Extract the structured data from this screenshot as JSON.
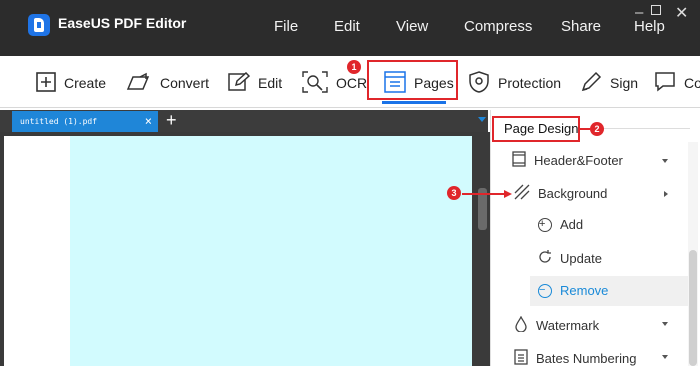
{
  "app": {
    "title": "EaseUS PDF Editor"
  },
  "menu": {
    "items": [
      "File",
      "Edit",
      "View",
      "Compress",
      "Share",
      "Help"
    ]
  },
  "toolbar": {
    "create": "Create",
    "convert": "Convert",
    "edit": "Edit",
    "ocr": "OCR",
    "pages": "Pages",
    "protection": "Protection",
    "sign": "Sign",
    "comment_partial": "Co"
  },
  "tabs": {
    "document": "untitled (1).pdf",
    "close": "×",
    "new_tab": "+"
  },
  "panel": {
    "title": "Page Design",
    "items": {
      "header_footer": "Header&Footer",
      "background": "Background",
      "add": "Add",
      "update": "Update",
      "remove": "Remove",
      "watermark": "Watermark",
      "bates": "Bates Numbering"
    }
  },
  "badges": {
    "one": "1",
    "two": "2",
    "three": "3"
  },
  "colors": {
    "titlebar": "#2c2c2c",
    "accent_blue": "#1f86d8",
    "annotation_red": "#e0262b",
    "page_fill": "#d2fbfe",
    "remove_text": "#1a8ad8"
  }
}
